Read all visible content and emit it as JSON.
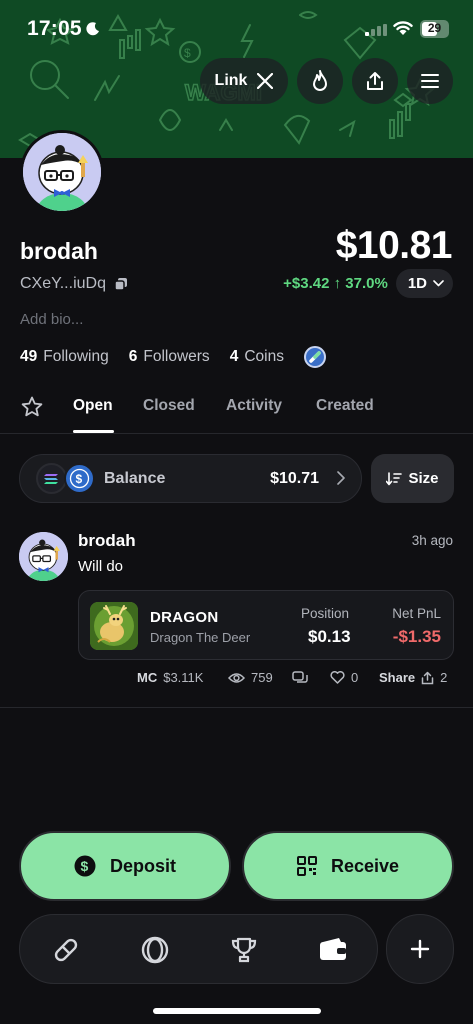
{
  "status_bar": {
    "time": "17:05",
    "battery": "29"
  },
  "header": {
    "link_label": "Link",
    "icons": [
      "x-logo-icon",
      "flame-icon",
      "share-icon",
      "menu-icon"
    ]
  },
  "profile": {
    "username": "brodah",
    "address": "CXeY...iuDq",
    "balance": "$10.81",
    "pnl": "+$3.42 ↑ 37.0%",
    "period": "1D",
    "bio_placeholder": "Add bio...",
    "following_count": "49",
    "following_label": "Following",
    "followers_count": "6",
    "followers_label": "Followers",
    "coins_count": "4",
    "coins_label": "Coins"
  },
  "tabs": [
    {
      "label": "Open",
      "active": true
    },
    {
      "label": "Closed"
    },
    {
      "label": "Activity"
    },
    {
      "label": "Created"
    }
  ],
  "balance_row": {
    "label": "Balance",
    "value": "$10.71",
    "size_label": "Size"
  },
  "post": {
    "author": "brodah",
    "time": "3h ago",
    "text": "Will do",
    "token": {
      "symbol": "DRAGON",
      "name": "Dragon The Deer",
      "position_label": "Position",
      "position_value": "$0.13",
      "pnl_label": "Net PnL",
      "pnl_value": "-$1.35"
    },
    "footer": {
      "mc_label": "MC",
      "mc_value": "$3.11K",
      "views": "759",
      "likes": "0",
      "share_label": "Share",
      "shares": "2"
    }
  },
  "actions": {
    "deposit_label": "Deposit",
    "receive_label": "Receive"
  },
  "colors": {
    "accent_green": "#8be4a6",
    "gain": "#5fd881",
    "loss": "#f06a6a",
    "banner": "#0f4a24"
  }
}
